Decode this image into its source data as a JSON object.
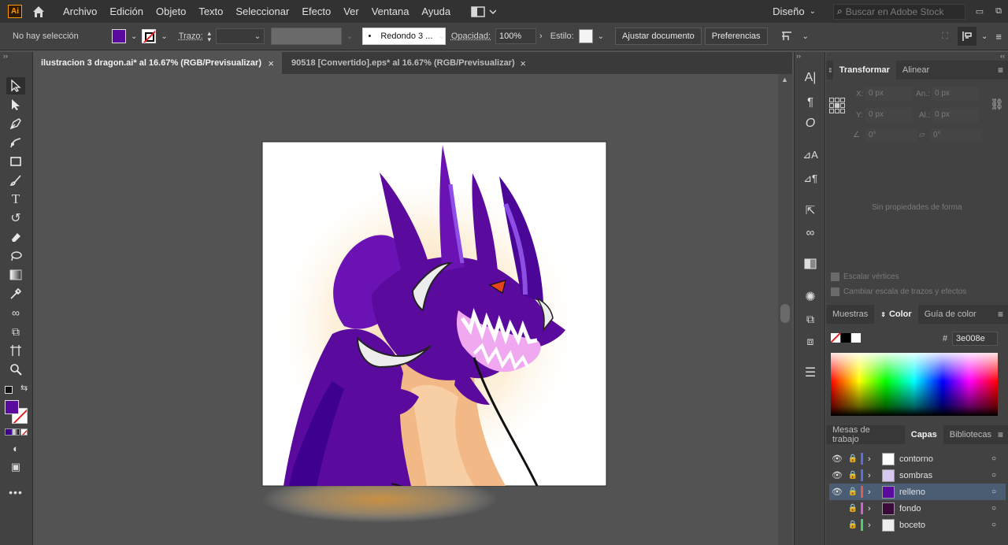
{
  "app": {
    "logo": "Ai",
    "workspace": "Diseño",
    "search_placeholder": "Buscar en Adobe Stock"
  },
  "menu": [
    "Archivo",
    "Edición",
    "Objeto",
    "Texto",
    "Seleccionar",
    "Efecto",
    "Ver",
    "Ventana",
    "Ayuda"
  ],
  "control": {
    "selection": "No hay selección",
    "stroke_label": "Trazo:",
    "brush": "Redondo 3 ...",
    "opacity_label": "Opacidad:",
    "opacity_value": "100%",
    "style_label": "Estilo:",
    "fit_button": "Ajustar documento",
    "prefs_button": "Preferencias",
    "fill_color": "#5b0a9e"
  },
  "tabs": [
    {
      "label": "ilustracion 3 dragon.ai* al 16.67% (RGB/Previsualizar)",
      "active": true
    },
    {
      "label": "90518 [Convertido].eps* al 16.67% (RGB/Previsualizar)",
      "active": false
    }
  ],
  "transform": {
    "tabs": [
      "Transformar",
      "Alinear"
    ],
    "x_label": "X:",
    "x_val": "0 px",
    "w_label": "An.:",
    "w_val": "0 px",
    "y_label": "Y:",
    "y_val": "0 px",
    "h_label": "Al.:",
    "h_val": "0 px",
    "angle": "0°",
    "shear": "0°",
    "no_props": "Sin propiedades de forma",
    "scale_corners": "Escalar vértices",
    "scale_strokes": "Cambiar escala de trazos y efectos"
  },
  "color": {
    "tabs": [
      "Muestras",
      "Color",
      "Guía de color"
    ],
    "hash": "#",
    "hex": "3e008e"
  },
  "layers_panel": {
    "tabs": [
      "Mesas de trabajo",
      "Capas",
      "Bibliotecas"
    ],
    "layers": [
      {
        "name": "contorno",
        "color": "#5a6ee0",
        "visible": true,
        "selected": false
      },
      {
        "name": "sombras",
        "color": "#5a6ee0",
        "visible": true,
        "selected": false
      },
      {
        "name": "relleno",
        "color": "#e05a5a",
        "visible": true,
        "selected": true
      },
      {
        "name": "fondo",
        "color": "#d060d0",
        "visible": false,
        "selected": false
      },
      {
        "name": "boceto",
        "color": "#4ad06a",
        "visible": false,
        "selected": false
      }
    ]
  }
}
